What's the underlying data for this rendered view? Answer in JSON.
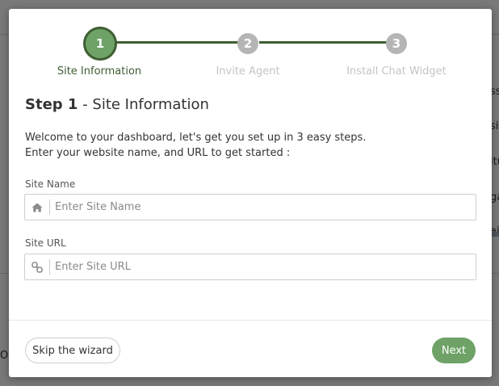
{
  "wizard": {
    "steps": [
      {
        "number": "1",
        "label": "Site Information"
      },
      {
        "number": "2",
        "label": "Invite Agent"
      },
      {
        "number": "3",
        "label": "Install Chat Widget"
      }
    ],
    "active_step": 1,
    "colors": {
      "accent": "#6ea267",
      "accent_dark": "#3f5e33",
      "inactive": "#b5b5b5",
      "inactive_text": "#c4c4c4"
    }
  },
  "content": {
    "title_strong": "Step 1",
    "title_rest": " - Site Information",
    "description_line1": "Welcome to your dashboard, let's get you set up in 3 easy steps.",
    "description_line2": "Enter your website name, and URL to get started :"
  },
  "form": {
    "site_name": {
      "label": "Site Name",
      "placeholder": "Enter Site Name",
      "value": "",
      "icon": "home-icon"
    },
    "site_url": {
      "label": "Site URL",
      "placeholder": "Enter Site URL",
      "value": "",
      "icon": "link-icon"
    }
  },
  "footer": {
    "skip_label": "Skip the wizard",
    "next_label": "Next"
  },
  "background": {
    "fragments": [
      "ss",
      "sit",
      "itu",
      "ga",
      "ai",
      "O"
    ]
  }
}
